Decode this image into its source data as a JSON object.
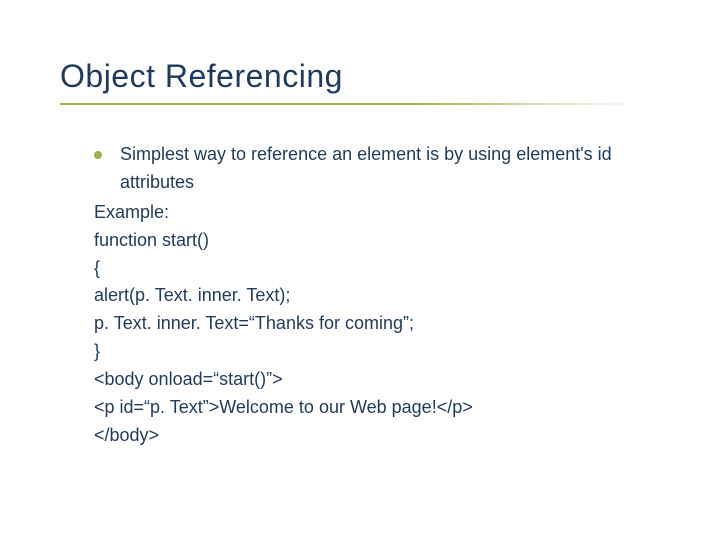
{
  "slide": {
    "title": "Object Referencing",
    "bullet1": "Simplest way to reference an element is by using element's id attributes",
    "lines": {
      "l0": "Example:",
      "l1": "function start()",
      "l2": "{",
      "l3": "alert(p. Text. inner. Text);",
      "l4": "p. Text. inner. Text=“Thanks for coming”;",
      "l5": "}",
      "l6": "<body onload=“start()”>",
      "l7": "<p id=“p. Text”>Welcome to our Web page!</p>",
      "l8": "</body>"
    }
  }
}
